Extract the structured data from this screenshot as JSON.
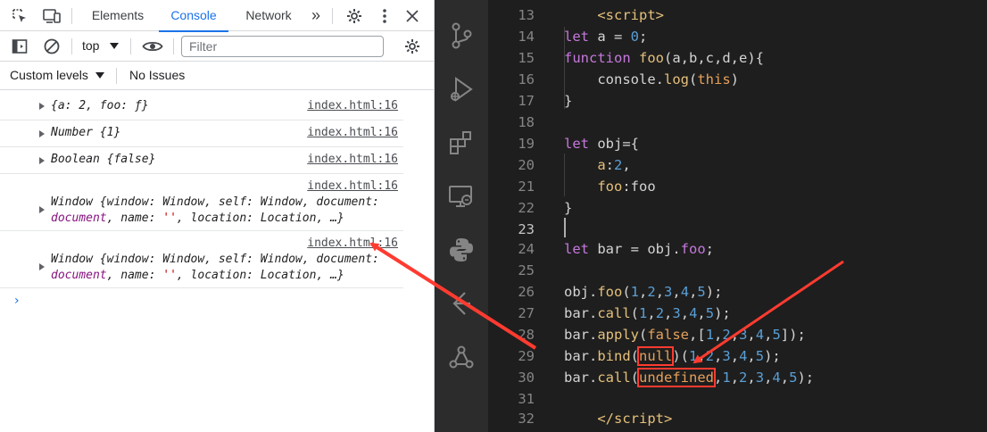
{
  "devtools": {
    "tabs": [
      {
        "label": "Elements"
      },
      {
        "label": "Console",
        "active": true
      },
      {
        "label": "Network"
      }
    ],
    "more_tabs": "»",
    "toolbar": {
      "context": "top",
      "filter_placeholder": "Filter"
    },
    "levels": {
      "label": "Custom levels",
      "issues": "No Issues"
    },
    "console_rows": [
      {
        "text": "{a: 2, foo: ƒ}",
        "source": "index.html:16"
      },
      {
        "text": "Number {1}",
        "source": "index.html:16"
      },
      {
        "text": "Boolean {false}",
        "source": "index.html:16"
      },
      {
        "line1": "Window {window: Window, self: Window, document:",
        "line2a": "document",
        "line2b": ", name: ",
        "line2c": "''",
        "line2d": ", location: Location, …}",
        "source": "index.html:16"
      },
      {
        "line1": "Window {window: Window, self: Window, document:",
        "line2a": "document",
        "line2b": ", name: ",
        "line2c": "''",
        "line2d": ", location: Location, …}",
        "source": "index.html:16"
      }
    ],
    "prompt": "›"
  },
  "editor": {
    "line_numbers": [
      "13",
      "14",
      "15",
      "16",
      "17",
      "18",
      "19",
      "20",
      "21",
      "22",
      "23",
      "24",
      "25",
      "26",
      "27",
      "28",
      "29",
      "30",
      "31",
      "32"
    ],
    "current_line": "23"
  },
  "colors": {
    "annotation": "#ff3b30",
    "accent": "#1a73e8"
  }
}
